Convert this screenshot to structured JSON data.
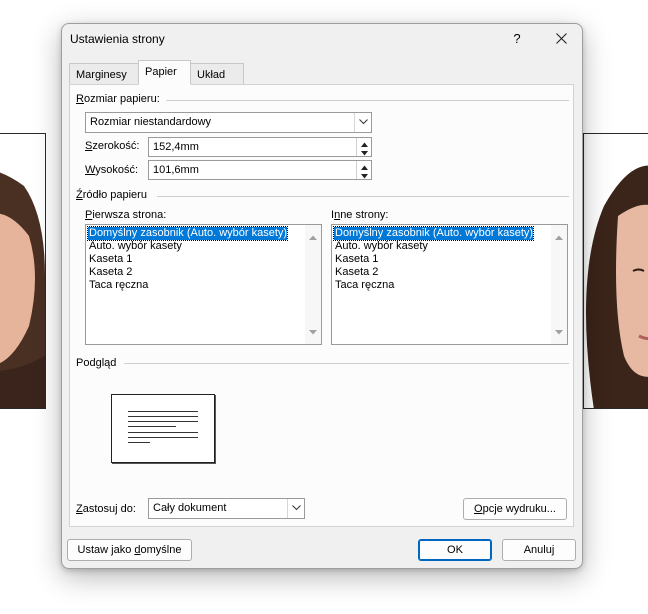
{
  "dialog": {
    "title": "Ustawienia strony",
    "help_label": "?",
    "close_label": "✕"
  },
  "tabs": [
    {
      "label": "Marginesy",
      "active": false
    },
    {
      "label": "Papier",
      "active": true
    },
    {
      "label": "Układ",
      "active": false
    }
  ],
  "paper_size": {
    "group_label": "Rozmiar papieru:",
    "selected": "Rozmiar niestandardowy",
    "width_label": "Szerokość:",
    "width_value": "152,4mm",
    "height_label": "Wysokość:",
    "height_value": "101,6mm"
  },
  "paper_source": {
    "group_label": "Źródło papieru",
    "first_page_label": "Pierwsza strona:",
    "other_pages_label": "Inne strony:",
    "first_page_items": [
      "Domyślny zasobnik (Auto. wybór kasety)",
      "Auto. wybór kasety",
      "Kaseta 1",
      "Kaseta 2",
      "Taca ręczna"
    ],
    "other_pages_items": [
      "Domyślny zasobnik (Auto. wybór kasety)",
      "Auto. wybór kasety",
      "Kaseta 1",
      "Kaseta 2",
      "Taca ręczna"
    ],
    "selected_index": 0
  },
  "preview": {
    "label": "Podgląd"
  },
  "apply_to": {
    "label": "Zastosuj do:",
    "selected": "Cały dokument"
  },
  "buttons": {
    "print_options": "Opcje wydruku...",
    "set_default": "Ustaw jako domyślne",
    "ok": "OK",
    "cancel": "Anuluj"
  },
  "colors": {
    "selection": "#0078d7",
    "dialog_bg": "#f0f0f0",
    "default_button_border": "#0067c0"
  }
}
